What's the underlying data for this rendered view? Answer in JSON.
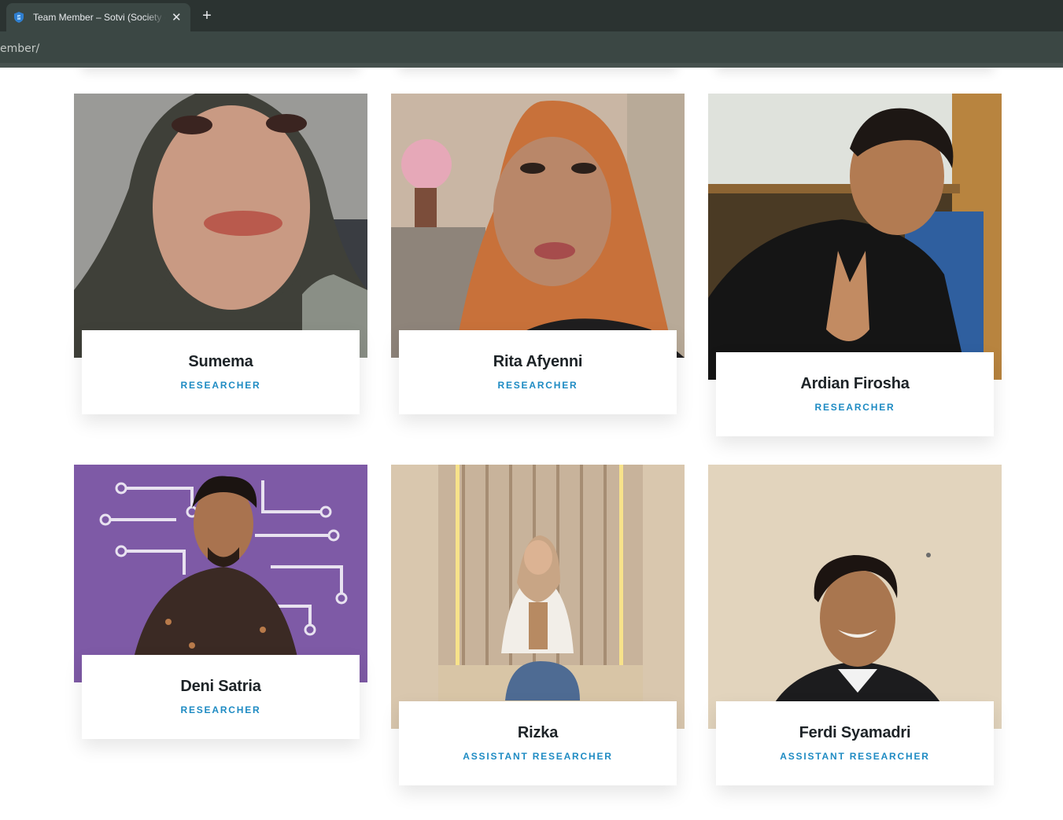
{
  "browser": {
    "tab_title": "Team Member – Sotvi (Society of ...",
    "url_fragment": "ember/",
    "new_tab_label": "+",
    "close_label": "✕"
  },
  "colors": {
    "accent": "#1e8bc3",
    "name_text": "#1d2327",
    "chrome_dark": "#2b3331",
    "chrome_light": "#3b4744"
  },
  "team": {
    "members": [
      {
        "name": "Sumema",
        "role": "RESEARCHER"
      },
      {
        "name": "Rita Afyenni",
        "role": "RESEARCHER"
      },
      {
        "name": "Ardian Firosha",
        "role": "RESEARCHER"
      },
      {
        "name": "Deni Satria",
        "role": "RESEARCHER"
      },
      {
        "name": "Rizka",
        "role": "ASSISTANT RESEARCHER"
      },
      {
        "name": "Ferdi Syamadri",
        "role": "ASSISTANT RESEARCHER"
      }
    ]
  }
}
